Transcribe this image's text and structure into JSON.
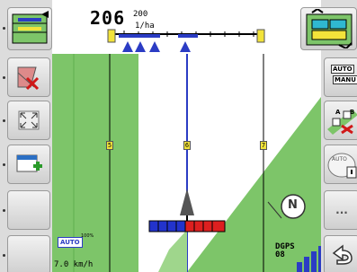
{
  "header": {
    "rate_value": "206",
    "rate_target": "200",
    "rate_unit": "1/ha"
  },
  "map": {
    "track_labels": [
      "5",
      "6",
      "7"
    ],
    "auto_badge": "AUTO",
    "auto_percent": "100%",
    "speed": "7.0 km/h",
    "dgps_label": "DGPS",
    "dgps_value": "08",
    "compass_label": "N"
  },
  "right_buttons": {
    "auto_manu_top": "AUTO",
    "auto_manu_bottom": "MANU",
    "ab_label": "A B",
    "auto_label": "AUTO",
    "more_label": "..."
  },
  "colors": {
    "field_green": "#7dc569",
    "section_blue": "#2233cc",
    "section_red": "#dd1f1f",
    "marker_blue": "#2b3cc4"
  }
}
